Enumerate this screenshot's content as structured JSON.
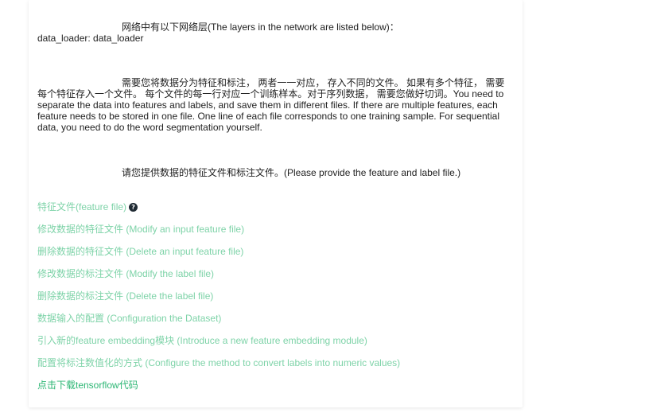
{
  "layers": {
    "heading": "网络中有以下网络层(The layers in the network are listed below)：",
    "item": "data_loader: data_loader"
  },
  "instructions": {
    "text": "需要您将数据分为特征和标注， 两者一一对应， 存入不同的文件。 如果有多个特征， 需要每个特征存入一个文件。 每个文件的每一行对应一个训练样本。对于序列数据， 需要您做好切词。You need to separate the data into features and labels, and save them in different files. If there are multiple features, each feature needs to be stored in one file. One line of each file corresponds to one training sample. For sequential data, you need to do the word segmentation yourself."
  },
  "request": {
    "text": "请您提供数据的特征文件和标注文件。(Please provide the feature and label file.)"
  },
  "links": {
    "feature_file": "特征文件(feature file)",
    "help_icon": "?",
    "modify_feature": "修改数据的特征文件 (Modify an input feature file)",
    "delete_feature": "删除数据的特征文件 (Delete an input feature file)",
    "modify_label": "修改数据的标注文件 (Modify the label file)",
    "delete_label": "删除数据的标注文件 (Delete the label file)",
    "config_dataset": "数据输入的配置 (Configuration the Dataset)",
    "introduce_embedding": "引入新的feature embedding模块 (Introduce a new feature embedding module)",
    "config_label_convert": "配置将标注数值化的方式 (Configure the method to convert labels into numeric values)",
    "download_code": "点击下载tensorflow代码"
  },
  "colors": {
    "link_light": "#7ed3a8",
    "link_dark": "#2bb673",
    "text": "#222222"
  }
}
